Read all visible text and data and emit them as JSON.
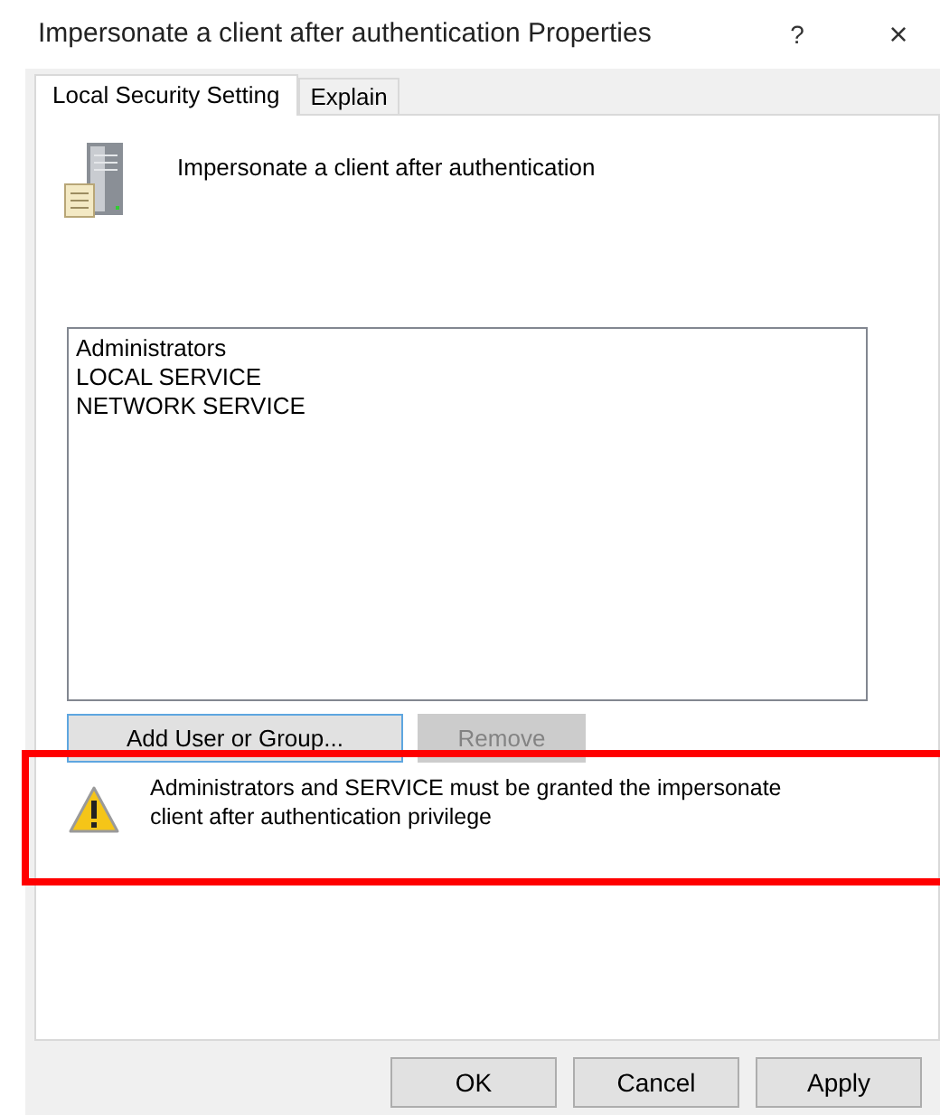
{
  "window": {
    "title": "Impersonate a client after authentication Properties",
    "help": "?",
    "close": "×"
  },
  "tabs": [
    {
      "label": "Local Security Setting",
      "selected": true
    },
    {
      "label": "Explain",
      "selected": false
    }
  ],
  "policy_name": "Impersonate a client after authentication",
  "members": [
    {
      "label": "Administrators",
      "selected": false
    },
    {
      "label": "LOCAL SERVICE",
      "selected": false
    },
    {
      "label": "NETWORK SERVICE",
      "selected": false
    }
  ],
  "member_buttons": [
    {
      "label": "Add User or Group...",
      "disabled": false,
      "focused": true
    },
    {
      "label": "Remove",
      "disabled": true,
      "focused": false
    }
  ],
  "warning": {
    "text": "Administrators and SERVICE must be granted the impersonate client after authentication privilege",
    "highlighted": true
  },
  "dialog_buttons": [
    {
      "label": "OK",
      "disabled": false
    },
    {
      "label": "Cancel",
      "disabled": false
    },
    {
      "label": "Apply",
      "disabled": false
    }
  ]
}
